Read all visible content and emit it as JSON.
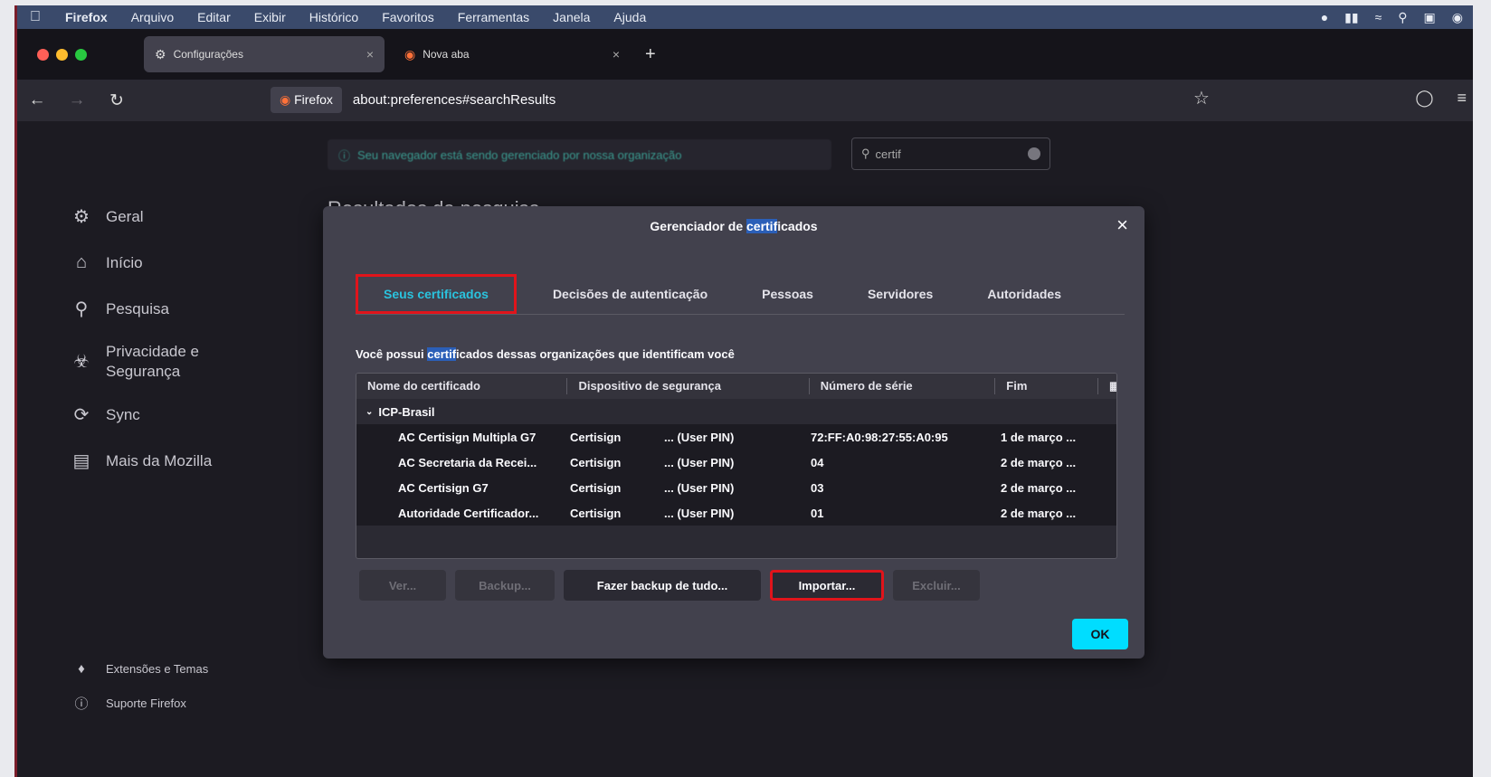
{
  "menubar": {
    "app": "Firefox",
    "items": [
      "Arquivo",
      "Editar",
      "Exibir",
      "Histórico",
      "Favoritos",
      "Ferramentas",
      "Janela",
      "Ajuda"
    ]
  },
  "tabs": [
    {
      "label": "Configurações",
      "icon": "gear-icon",
      "active": true
    },
    {
      "label": "Nova aba",
      "icon": "firefox-icon",
      "active": false
    }
  ],
  "navbar": {
    "identity_label": "Firefox",
    "url": "about:preferences#searchResults"
  },
  "page": {
    "policy_notice": "Seu navegador está sendo gerenciado por nossa organização",
    "search_value": "certif",
    "results_title": "Resultados da pesquisa"
  },
  "sidebar": {
    "items": [
      {
        "label": "Geral",
        "icon": "gear-icon"
      },
      {
        "label": "Início",
        "icon": "home-icon"
      },
      {
        "label": "Pesquisa",
        "icon": "search-icon"
      },
      {
        "label": "Privacidade e Segurança",
        "icon": "lock-icon"
      },
      {
        "label": "Sync",
        "icon": "sync-icon"
      },
      {
        "label": "Mais da Mozilla",
        "icon": "mozilla-icon"
      }
    ],
    "bottom": [
      {
        "label": "Extensões e Temas",
        "icon": "puzzle-icon"
      },
      {
        "label": "Suporte Firefox",
        "icon": "help-icon"
      }
    ]
  },
  "dialog": {
    "title_pre": "Gerenciador de ",
    "title_hl": "certif",
    "title_post": "icados",
    "tabs": [
      "Seus certificados",
      "Decisões de autenticação",
      "Pessoas",
      "Servidores",
      "Autoridades"
    ],
    "desc_pre": "Você possui ",
    "desc_hl": "certif",
    "desc_post": "icados dessas organizações que identificam você",
    "columns": [
      "Nome do certificado",
      "Dispositivo de segurança",
      "Número de série",
      "Fim"
    ],
    "group": "ICP-Brasil",
    "rows": [
      {
        "name": "AC Certisign Multipla G7",
        "device": "Certisign",
        "pin": "... (User PIN)",
        "serial": "72:FF:A0:98:27:55:A0:95",
        "end": "1 de março ..."
      },
      {
        "name": "AC Secretaria da Recei...",
        "device": "Certisign",
        "pin": "... (User PIN)",
        "serial": "04",
        "end": "2 de março ..."
      },
      {
        "name": "AC Certisign G7",
        "device": "Certisign",
        "pin": "... (User PIN)",
        "serial": "03",
        "end": "2 de março ..."
      },
      {
        "name": "Autoridade Certificador...",
        "device": "Certisign",
        "pin": "... (User PIN)",
        "serial": "01",
        "end": "2 de março ..."
      }
    ],
    "buttons": {
      "view": "Ver...",
      "backup": "Backup...",
      "backup_all": "Fazer backup de tudo...",
      "import": "Importar...",
      "delete": "Excluir..."
    },
    "ok": "OK"
  },
  "colors": {
    "highlight": "#e0141b",
    "accent": "#00ddff",
    "selected_tab": "#2ac3de"
  }
}
